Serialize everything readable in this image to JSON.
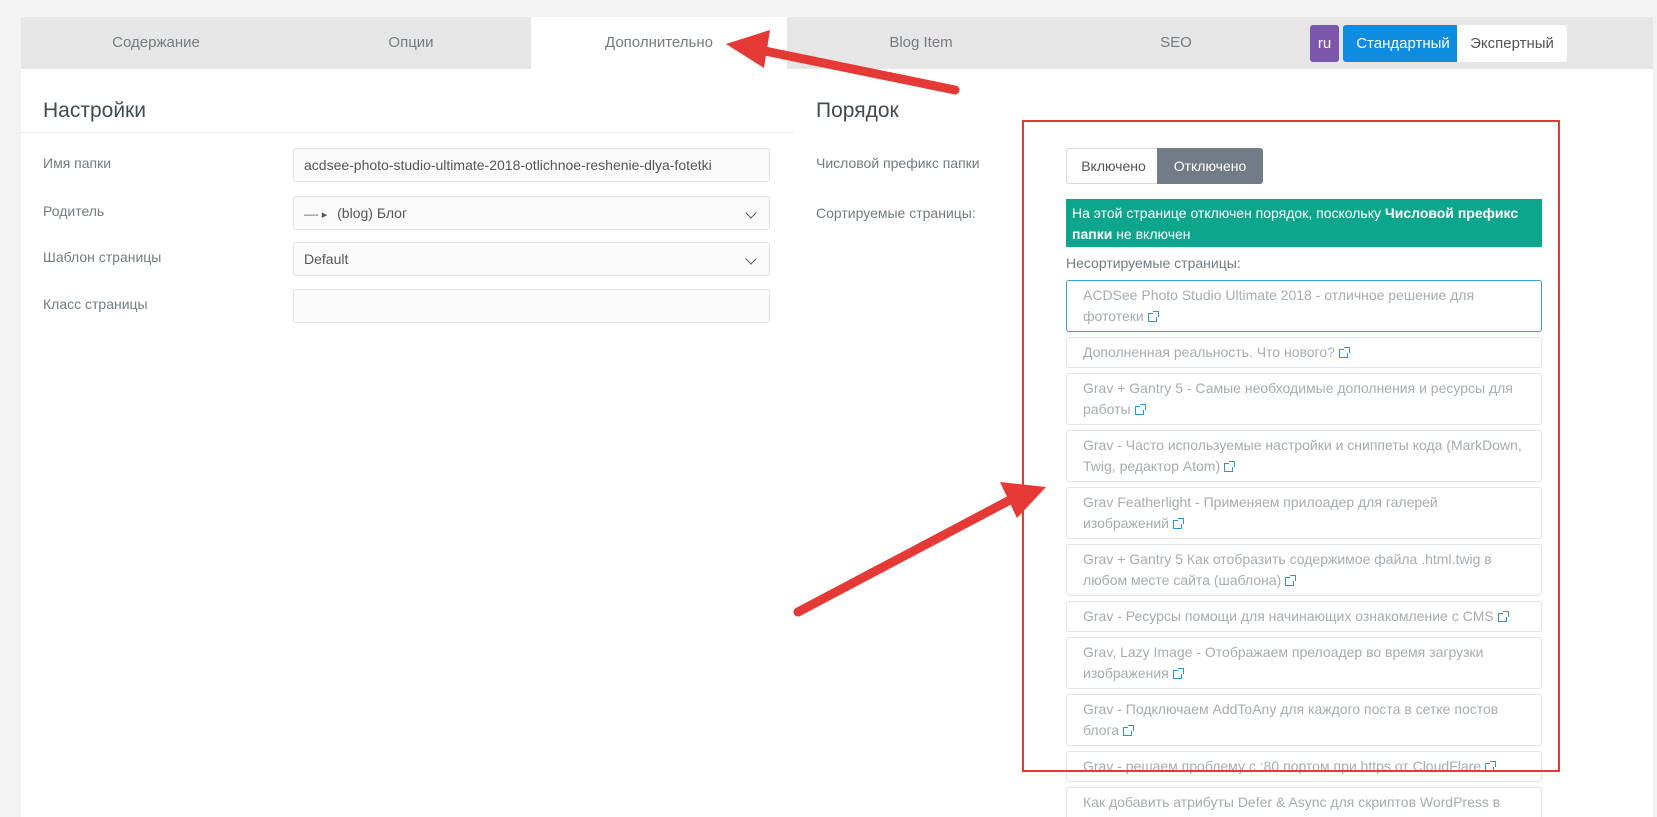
{
  "tabs": [
    "Содержание",
    "Опции",
    "Дополнительно",
    "Blog Item",
    "SEO"
  ],
  "active_tab": "Дополнительно",
  "lang": "ru",
  "mode": {
    "standard": "Стандартный",
    "expert": "Экспертный"
  },
  "left": {
    "title": "Настройки",
    "folder_label": "Имя папки",
    "folder_value": "acdsee-photo-studio-ultimate-2018-otlichnoe-reshenie-dlya-fotetki",
    "parent_label": "Родитель",
    "parent_prefix": "—- ▸",
    "parent_value": "(blog) Блог",
    "template_label": "Шаблон страницы",
    "template_value": "Default",
    "class_label": "Класс страницы",
    "class_value": ""
  },
  "right": {
    "title": "Порядок",
    "prefix_label": "Числовой префикс папки",
    "toggle_on": "Включено",
    "toggle_off": "Отключено",
    "sortable_label": "Сортируемые страницы:",
    "notice_pre": "На этой странице отключен порядок, поскольку ",
    "notice_bold": "Числовой префикс папки",
    "notice_post": " не включен",
    "unsortable_label": "Несортируемые страницы:",
    "pages": [
      "ACDSee Photo Studio Ultimate 2018 - отличное решение для фототеки",
      "Дополненная реальность. Что нового?",
      "Grav + Gantry 5 - Самые необходимые дополнения и ресурсы для работы",
      "Grav - Часто используемые настройки и сниппеты кода (MarkDown, Twig, редактор Atom)",
      "Grav Featherlight - Применяем прилоадер для галерей изображений",
      "Grav + Gantry 5 Как отобразить содержимое файла .html.twig в любом месте сайта (шаблона)",
      "Grav - Ресурсы помощи для начинающих ознакомление с CMS",
      "Grav, Lazy Image - Отображаем прелоадер во время загрузки изображения",
      "Grav - Подключаем AddToAny для каждого поста в сетке постов блога",
      "Grav - решаем проблему с :80 портом при https от CloudFlare",
      "Как добавить атрибуты Defer & Async для скриптов WordPress в function.php"
    ]
  },
  "colors": {
    "accent": "#0d8ce0",
    "notice": "#0ca68d",
    "annotation": "#e53935",
    "lang_badge": "#7c56ab"
  }
}
